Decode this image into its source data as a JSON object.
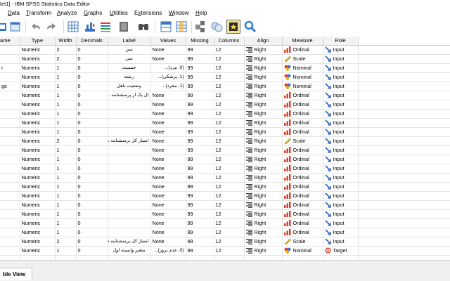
{
  "window": {
    "title": "Set1] - IBM SPSS Statistics Data Editor"
  },
  "menu": [
    {
      "label": "Data",
      "key": "D"
    },
    {
      "label": "Transform",
      "key": "T"
    },
    {
      "label": "Analyze",
      "key": "A"
    },
    {
      "label": "Graphs",
      "key": "G"
    },
    {
      "label": "Utilities",
      "key": "U"
    },
    {
      "label": "Extensions",
      "key": "x"
    },
    {
      "label": "Window",
      "key": "W"
    },
    {
      "label": "Help",
      "key": "H"
    }
  ],
  "toolbar": [
    "open-data-icon",
    "undo-icon",
    "redo-icon",
    "go-to-case-icon",
    "go-to-variable-icon",
    "variables-icon",
    "find-icon",
    "insert-cases-icon",
    "insert-variable-icon",
    "split-file-icon",
    "weight-cases-icon",
    "select-cases-icon",
    "search-icon"
  ],
  "columns": [
    "ame",
    "Type",
    "Width",
    "Decimals",
    "Label",
    "Values",
    "Missing",
    "Columns",
    "Align",
    "Measure",
    "Role"
  ],
  "measure_colors": {
    "ordinal": "#d9412b",
    "scale": "#e2b21a",
    "nominal": "#3b6fd1"
  },
  "rows": [
    {
      "name": "",
      "type": "Numeric",
      "width": "2",
      "decimals": "0",
      "label": "سن",
      "values": "None",
      "missing": "99",
      "columns": "12",
      "align": "Right",
      "measure": "Ordinal",
      "role": "Input"
    },
    {
      "name": "",
      "type": "Numeric",
      "width": "2",
      "decimals": "0",
      "label": "سن",
      "values": "None",
      "missing": "99",
      "columns": "12",
      "align": "Right",
      "measure": "Scale",
      "role": "Input"
    },
    {
      "name": "r",
      "type": "Numeric",
      "width": "1",
      "decimals": "0",
      "label": "جنسیت",
      "values": "{0, مرد}...",
      "missing": "99",
      "columns": "12",
      "align": "Right",
      "measure": "Nominal",
      "role": "Input"
    },
    {
      "name": "",
      "type": "Numeric",
      "width": "1",
      "decimals": "0",
      "label": "رشته",
      "values": "{1, پزشکی}...",
      "missing": "99",
      "columns": "12",
      "align": "Right",
      "measure": "Nominal",
      "role": "Input"
    },
    {
      "name": "ge",
      "type": "Numeric",
      "width": "1",
      "decimals": "0",
      "label": "وضعیت تاهل",
      "values": "{1, مجرد}...",
      "missing": "99",
      "columns": "12",
      "align": "Right",
      "measure": "Nominal",
      "role": "Input"
    },
    {
      "name": "",
      "type": "Numeric",
      "width": "1",
      "decimals": "0",
      "label": "ال یک از پرسشنامه ...",
      "values": "None",
      "missing": "99",
      "columns": "12",
      "align": "Right",
      "measure": "Ordinal",
      "role": "Input"
    },
    {
      "name": "",
      "type": "Numeric",
      "width": "1",
      "decimals": "0",
      "label": "",
      "values": "None",
      "missing": "99",
      "columns": "12",
      "align": "Right",
      "measure": "Ordinal",
      "role": "Input"
    },
    {
      "name": "",
      "type": "Numeric",
      "width": "1",
      "decimals": "0",
      "label": "",
      "values": "None",
      "missing": "99",
      "columns": "12",
      "align": "Right",
      "measure": "Ordinal",
      "role": "Input"
    },
    {
      "name": "",
      "type": "Numeric",
      "width": "1",
      "decimals": "0",
      "label": "",
      "values": "None",
      "missing": "99",
      "columns": "12",
      "align": "Right",
      "measure": "Ordinal",
      "role": "Input"
    },
    {
      "name": "",
      "type": "Numeric",
      "width": "1",
      "decimals": "0",
      "label": "",
      "values": "None",
      "missing": "99",
      "columns": "12",
      "align": "Right",
      "measure": "Ordinal",
      "role": "Input"
    },
    {
      "name": "",
      "type": "Numeric",
      "width": "2",
      "decimals": "0",
      "label": "امتیاز کل پرسشنامه یک",
      "values": "None",
      "missing": "99",
      "columns": "12",
      "align": "Right",
      "measure": "Scale",
      "role": "Input"
    },
    {
      "name": "",
      "type": "Numeric",
      "width": "1",
      "decimals": "0",
      "label": "",
      "values": "None",
      "missing": "99",
      "columns": "12",
      "align": "Right",
      "measure": "Ordinal",
      "role": "Input"
    },
    {
      "name": "",
      "type": "Numeric",
      "width": "1",
      "decimals": "0",
      "label": "",
      "values": "None",
      "missing": "99",
      "columns": "12",
      "align": "Right",
      "measure": "Ordinal",
      "role": "Input"
    },
    {
      "name": "",
      "type": "Numeric",
      "width": "1",
      "decimals": "0",
      "label": "",
      "values": "None",
      "missing": "99",
      "columns": "12",
      "align": "Right",
      "measure": "Ordinal",
      "role": "Input"
    },
    {
      "name": "",
      "type": "Numeric",
      "width": "1",
      "decimals": "0",
      "label": "",
      "values": "None",
      "missing": "99",
      "columns": "12",
      "align": "Right",
      "measure": "Ordinal",
      "role": "Input"
    },
    {
      "name": "",
      "type": "Numeric",
      "width": "1",
      "decimals": "0",
      "label": "",
      "values": "None",
      "missing": "99",
      "columns": "12",
      "align": "Right",
      "measure": "Ordinal",
      "role": "Input"
    },
    {
      "name": "",
      "type": "Numeric",
      "width": "1",
      "decimals": "0",
      "label": "",
      "values": "None",
      "missing": "99",
      "columns": "12",
      "align": "Right",
      "measure": "Ordinal",
      "role": "Input"
    },
    {
      "name": "",
      "type": "Numeric",
      "width": "1",
      "decimals": "0",
      "label": "",
      "values": "None",
      "missing": "99",
      "columns": "12",
      "align": "Right",
      "measure": "Ordinal",
      "role": "Input"
    },
    {
      "name": "",
      "type": "Numeric",
      "width": "1",
      "decimals": "0",
      "label": "",
      "values": "None",
      "missing": "99",
      "columns": "12",
      "align": "Right",
      "measure": "Ordinal",
      "role": "Input"
    },
    {
      "name": "",
      "type": "Numeric",
      "width": "1",
      "decimals": "0",
      "label": "",
      "values": "None",
      "missing": "99",
      "columns": "12",
      "align": "Right",
      "measure": "Ordinal",
      "role": "Input"
    },
    {
      "name": "",
      "type": "Numeric",
      "width": "1",
      "decimals": "0",
      "label": "",
      "values": "None",
      "missing": "99",
      "columns": "12",
      "align": "Right",
      "measure": "Ordinal",
      "role": "Input"
    },
    {
      "name": "",
      "type": "Numeric",
      "width": "2",
      "decimals": "0",
      "label": "امتیاز کل پرسشنامه دو",
      "values": "None",
      "missing": "99",
      "columns": "12",
      "align": "Right",
      "measure": "Scale",
      "role": "Input"
    },
    {
      "name": "",
      "type": "Numeric",
      "width": "1",
      "decimals": "0",
      "label": "متغیر وابسته اول",
      "values": "{0, عدم بروز}...",
      "missing": "99",
      "columns": "12",
      "align": "Right",
      "measure": "Nominal",
      "role": "Target"
    },
    {
      "name": "",
      "type": "",
      "width": "",
      "decimals": "",
      "label": "",
      "values": "",
      "missing": "",
      "columns": "",
      "align": "",
      "measure": "",
      "role": ""
    }
  ],
  "bottom": {
    "tab_label": "ble View"
  }
}
